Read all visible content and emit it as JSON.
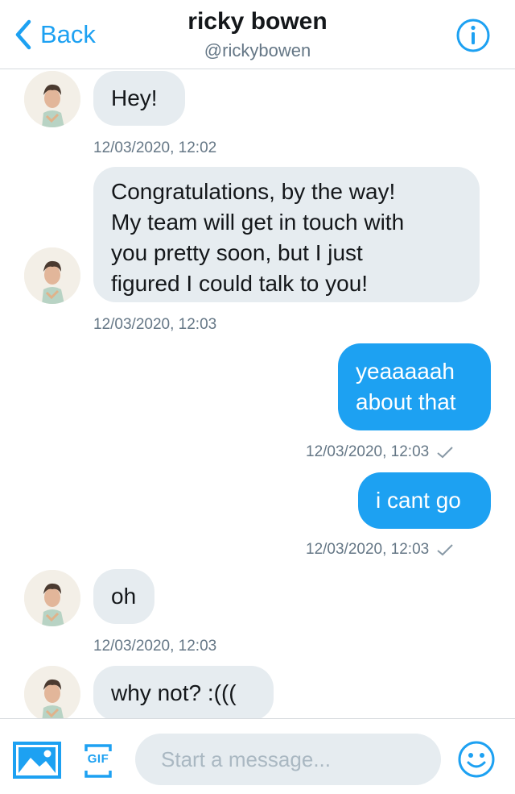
{
  "header": {
    "back_label": "Back",
    "name": "ricky bowen",
    "handle": "@rickybowen"
  },
  "messages": [
    {
      "side": "in",
      "text": "Hey!",
      "timestamp": "12/03/2020, 12:02"
    },
    {
      "side": "in",
      "text": "Congratulations, by the way!\nMy team will get in touch with\nyou pretty soon, but I just\nfigured I could talk to you!",
      "timestamp": "12/03/2020, 12:03"
    },
    {
      "side": "out",
      "text": "yeaaaaah\nabout that",
      "timestamp": "12/03/2020, 12:03"
    },
    {
      "side": "out",
      "text": "i cant go",
      "timestamp": "12/03/2020, 12:03"
    },
    {
      "side": "in",
      "text": "oh",
      "timestamp": "12/03/2020, 12:03"
    },
    {
      "side": "in",
      "text": "why not? :(((",
      "timestamp": ""
    }
  ],
  "composer": {
    "placeholder": "Start a message...",
    "gif_label": "GIF"
  },
  "colors": {
    "accent": "#1da1f2",
    "incoming_bubble": "#e6ecf0",
    "timestamp": "#657786"
  },
  "icons": {
    "back": "chevron-left-icon",
    "info": "info-icon",
    "image": "image-icon",
    "gif": "gif-icon",
    "emoji": "emoji-icon",
    "sent": "checkmark-icon"
  }
}
